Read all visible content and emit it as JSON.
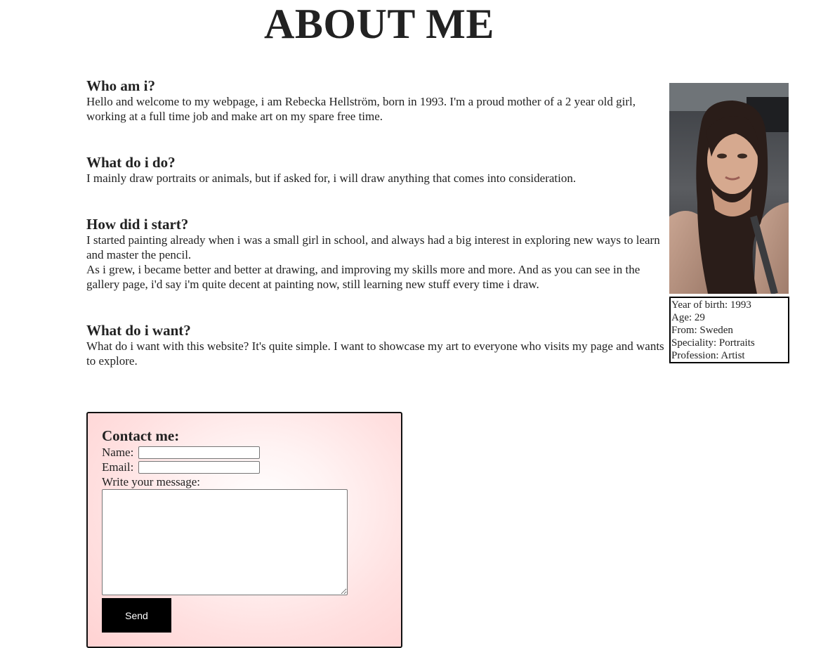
{
  "header": {
    "title": "ABOUT ME"
  },
  "sections": [
    {
      "heading": "Who am i?",
      "paragraphs": [
        "Hello and welcome to my webpage, i am Rebecka Hellström, born in 1993. I'm a proud mother of a 2 year old girl, working at a full time job and make art on my spare free time."
      ]
    },
    {
      "heading": "What do i do?",
      "paragraphs": [
        "I mainly draw portraits or animals, but if asked for, i will draw anything that comes into consideration."
      ]
    },
    {
      "heading": "How did i start?",
      "paragraphs": [
        "I started painting already when i was a small girl in school, and always had a big interest in exploring new ways to learn and master the pencil.",
        "As i grew, i became better and better at drawing, and improving my skills more and more. And as you can see in the gallery page, i'd say i'm quite decent at painting now, still learning new stuff every time i draw."
      ]
    },
    {
      "heading": "What do i want?",
      "paragraphs": [
        "What do i want with this website? It's quite simple. I want to showcase my art to everyone who visits my page and wants to explore."
      ]
    }
  ],
  "profile": {
    "photo_icon": "portrait-photo",
    "info": [
      "Year of birth: 1993",
      "Age: 29",
      "From: Sweden",
      "Speciality: Portraits",
      "Profession: Artist"
    ]
  },
  "contact": {
    "heading": "Contact me:",
    "name_label": "Name:",
    "name_value": "",
    "email_label": "Email:",
    "email_value": "",
    "message_label": "Write your message:",
    "message_value": "",
    "send_label": "Send"
  },
  "colors": {
    "text": "#222222",
    "contact_bg_edge": "#ffd2d2",
    "button_bg": "#000000",
    "button_text": "#ffffff"
  }
}
